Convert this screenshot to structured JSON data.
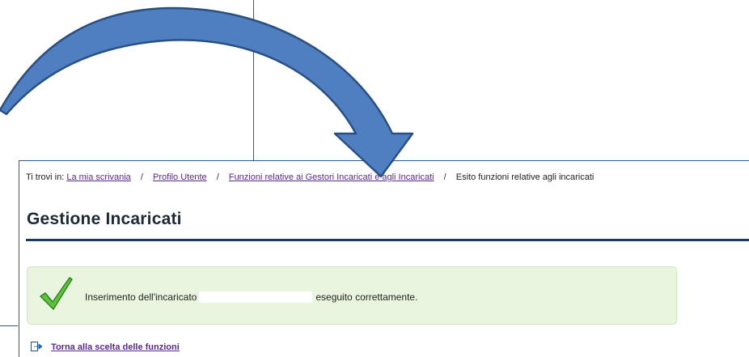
{
  "breadcrumb": {
    "prefix": "Ti trovi in:",
    "items": [
      {
        "label": "La mia scrivania"
      },
      {
        "label": "Profilo Utente"
      },
      {
        "label": "Funzioni relative ai Gestori Incaricati e agli Incaricati"
      }
    ],
    "separator": "/",
    "current": "Esito funzioni relative agli incaricati"
  },
  "page": {
    "title": "Gestione Incaricati"
  },
  "message": {
    "text_before": "Inserimento dell'incaricato",
    "text_after": "eseguito correttamente."
  },
  "actions": {
    "back_label": "Torna alla scelta delle funzioni"
  },
  "icons": {
    "status": "checkmark-icon",
    "back": "back-arrow-icon",
    "annotation": "curved-arrow-annotation"
  },
  "colors": {
    "link": "#5b2a86",
    "title_rule": "#1b3a63",
    "success_bg": "#e9f5de",
    "success_border": "#cfe6bd",
    "checkmark": "#5cc33a",
    "arrow_fill": "#4f7fc0",
    "arrow_stroke": "#2a4f82"
  }
}
